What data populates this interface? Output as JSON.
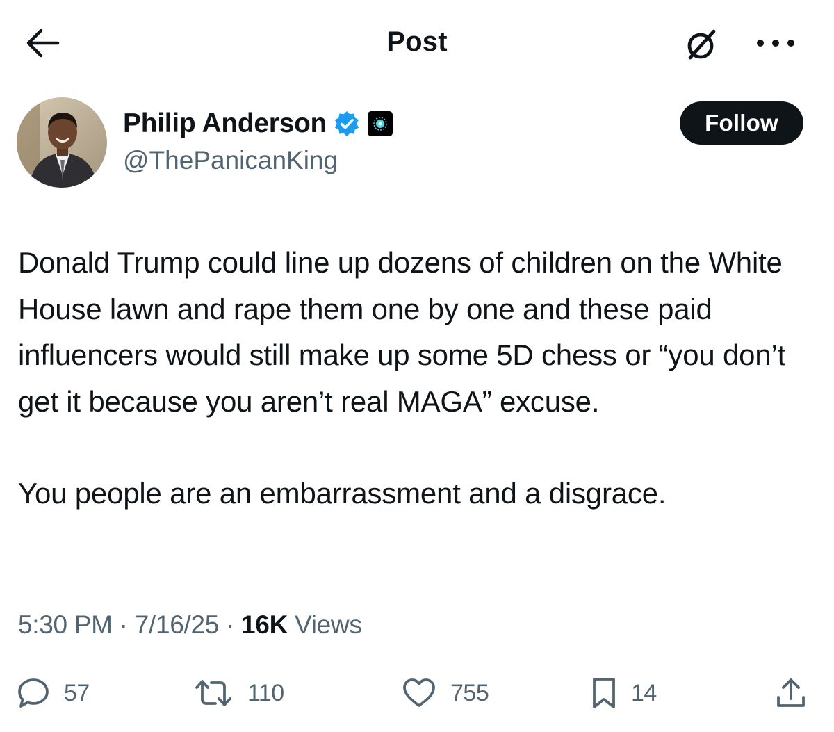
{
  "header": {
    "title": "Post",
    "back_icon": "arrow-left-icon",
    "grok_icon": "grok-icon",
    "more_icon": "more-horizontal-icon"
  },
  "author": {
    "name": "Philip Anderson",
    "handle": "@ThePanicanKing",
    "verified": true,
    "verified_color": "#1d9bf0",
    "affiliate_badge_icon": "affiliate-badge-icon"
  },
  "follow_button": {
    "label": "Follow"
  },
  "post": {
    "paragraphs": [
      "Donald Trump could line up dozens of children on the White House lawn and rape them one by one and these paid influencers would still make up some 5D chess or “you don’t get it because you aren’t real MAGA” excuse.",
      "You people are an embarrassment and a disgrace."
    ]
  },
  "meta": {
    "time": "5:30 PM",
    "separator": " · ",
    "date": "7/16/25",
    "views_count": "16K",
    "views_label": " Views"
  },
  "actions": {
    "reply": "57",
    "repost": "110",
    "like": "755",
    "bookmark": "14"
  },
  "colors": {
    "text": "#0f1419",
    "secondary": "#536471",
    "accent": "#1d9bf0",
    "follow_bg": "#0f1419"
  }
}
